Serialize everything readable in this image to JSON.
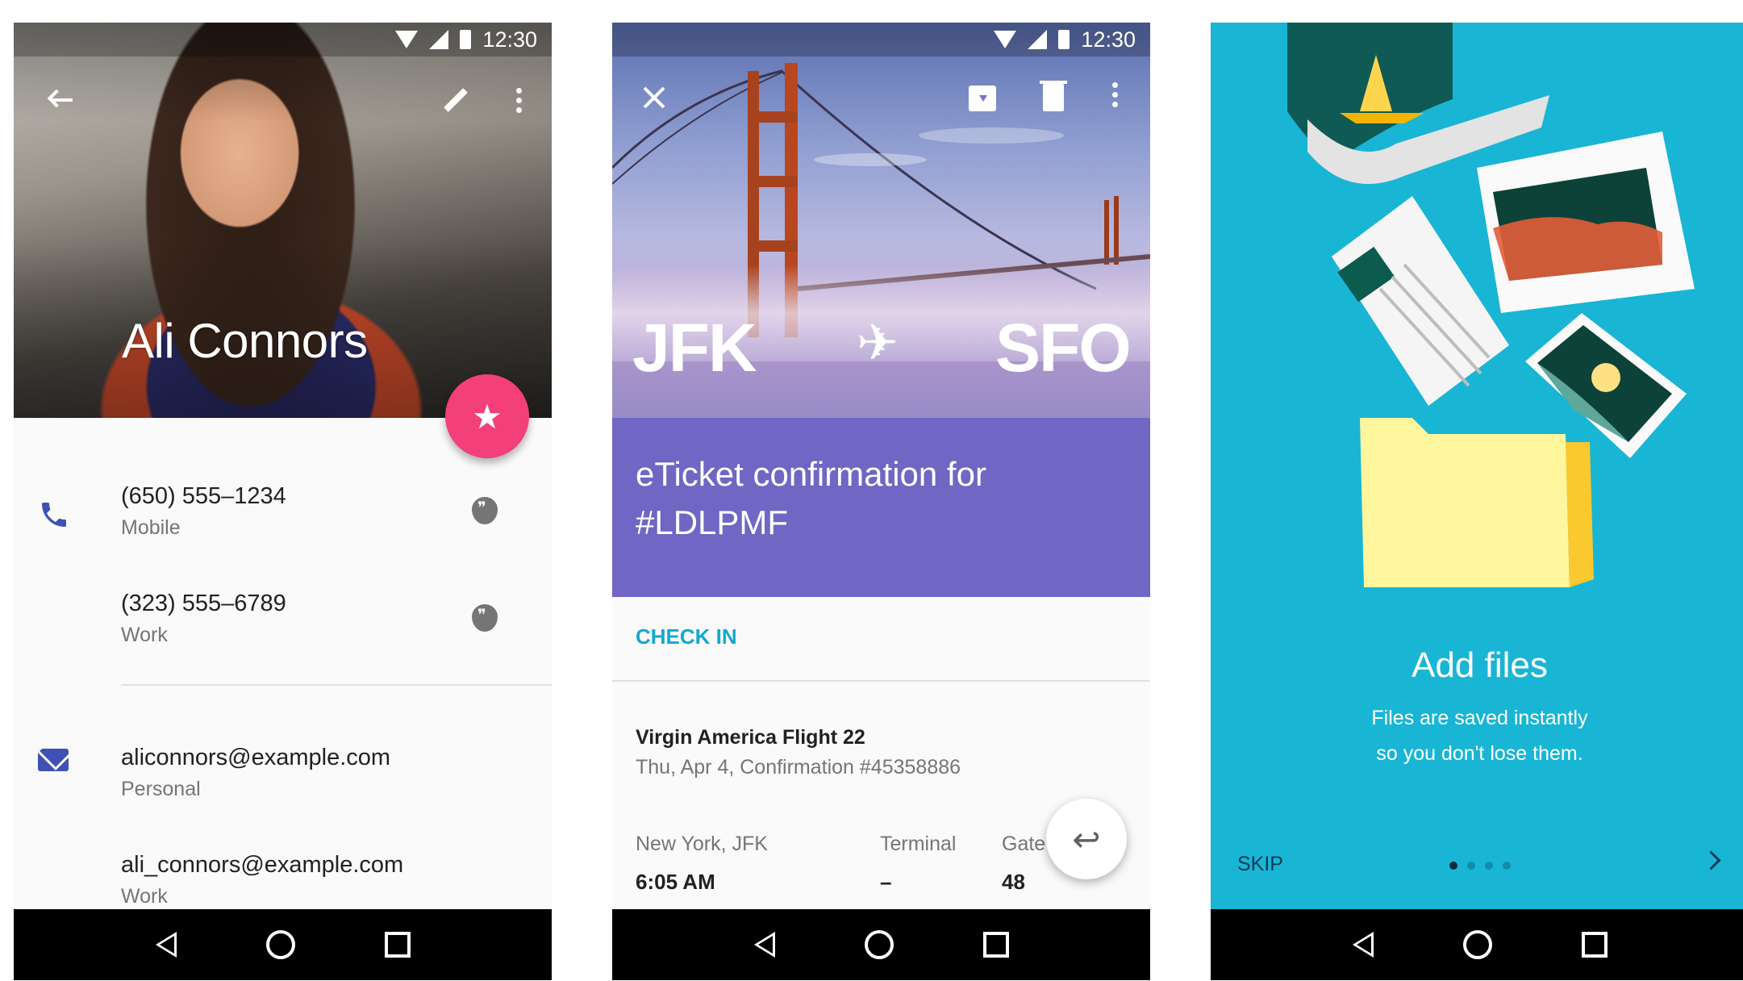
{
  "status": {
    "time": "12:30"
  },
  "contact": {
    "name": "Ali Connors",
    "phones": [
      {
        "number": "(650) 555–1234",
        "type": "Mobile"
      },
      {
        "number": "(323) 555–6789",
        "type": "Work"
      }
    ],
    "emails": [
      {
        "address": "aliconnors@example.com",
        "type": "Personal"
      },
      {
        "address": "ali_connors@example.com",
        "type": "Work"
      }
    ],
    "accent_color": "#3f51b5",
    "fab_color": "#f33f7a"
  },
  "ticket": {
    "from": "JFK",
    "to": "SFO",
    "title": "eTicket confirmation for #LDLPMF",
    "check_in_label": "CHECK IN",
    "flight": "Virgin America Flight 22",
    "details": "Thu, Apr 4, Confirmation #45358886",
    "columns": [
      {
        "header": "New York, JFK",
        "value": "6:05 AM"
      },
      {
        "header": "Terminal",
        "value": "–"
      },
      {
        "header": "Gate",
        "value": "48"
      }
    ],
    "band_color": "#7066c4",
    "link_color": "#12a9cf"
  },
  "onboarding": {
    "title": "Add files",
    "desc_line1": "Files are saved instantly",
    "desc_line2": "so you don't lose them.",
    "skip_label": "SKIP",
    "page_index": 1,
    "page_count": 4,
    "background": "#19b5d5"
  },
  "icons": {
    "phone1": [
      "arrow-back-icon",
      "edit-icon",
      "more-vert-icon",
      "star-icon",
      "phone-icon",
      "hangouts-icon",
      "email-icon"
    ],
    "phone2": [
      "close-icon",
      "archive-icon",
      "delete-icon",
      "more-vert-icon",
      "airplane-icon",
      "reply-icon"
    ],
    "phone3": [
      "chevron-right-icon"
    ],
    "nav": [
      "back-icon",
      "home-icon",
      "recents-icon"
    ]
  }
}
